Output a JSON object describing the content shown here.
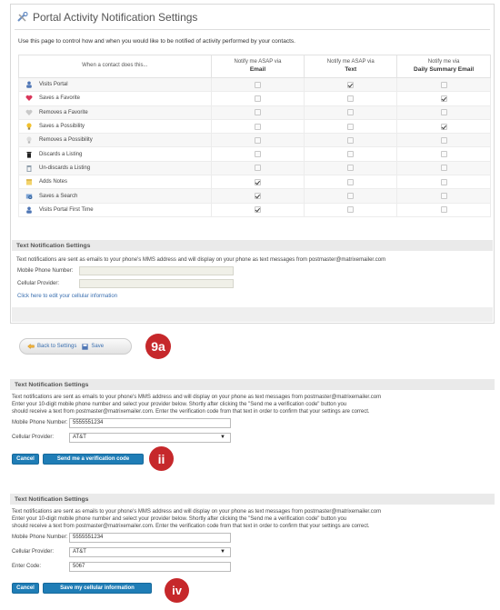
{
  "page": {
    "title": "Portal Activity Notification Settings",
    "intro": "Use this page to control how and when you would like to be notified of activity performed by your contacts."
  },
  "table": {
    "col_activity": "When a contact does this...",
    "col_email_top": "Notify me ASAP via",
    "col_email_bold": "Email",
    "col_text_top": "Notify me ASAP via",
    "col_text_bold": "Text",
    "col_daily_top": "Notify me via",
    "col_daily_bold": "Daily Summary Email",
    "rows": [
      {
        "label": "Visits Portal",
        "icon": "person-icon",
        "email": false,
        "text": true,
        "daily": false
      },
      {
        "label": "Saves a Favorite",
        "icon": "heart-icon",
        "email": false,
        "text": false,
        "daily": true
      },
      {
        "label": "Removes a Favorite",
        "icon": "heart-remove-icon",
        "email": false,
        "text": false,
        "daily": false
      },
      {
        "label": "Saves a Possibility",
        "icon": "lightbulb-icon",
        "email": false,
        "text": false,
        "daily": true
      },
      {
        "label": "Removes a Possibility",
        "icon": "lightbulb-remove-icon",
        "email": false,
        "text": false,
        "daily": false
      },
      {
        "label": "Discards a Listing",
        "icon": "trash-icon",
        "email": false,
        "text": false,
        "daily": false
      },
      {
        "label": "Un-discards a Listing",
        "icon": "trash-restore-icon",
        "email": false,
        "text": false,
        "daily": false
      },
      {
        "label": "Adds Notes",
        "icon": "notes-icon",
        "email": true,
        "text": false,
        "daily": false
      },
      {
        "label": "Saves a Search",
        "icon": "search-save-icon",
        "email": true,
        "text": false,
        "daily": false
      },
      {
        "label": "Visits Portal First Time",
        "icon": "person-icon",
        "email": true,
        "text": false,
        "daily": false
      }
    ]
  },
  "text_settings_1": {
    "heading": "Text Notification Settings",
    "description": "Text notifications are sent as emails to your phone's MMS address and will display on your phone as text messages from postmaster@matrixemailer.com",
    "mobile_label": "Mobile Phone Number:",
    "provider_label": "Cellular Provider:",
    "edit_link": "Click here to edit your cellular information"
  },
  "toolbar": {
    "back_label": "Back to Settings",
    "save_label": "Save"
  },
  "markers": {
    "m1": "9a",
    "m2": "ii",
    "m3": "iv"
  },
  "text_settings_2": {
    "heading": "Text Notification Settings",
    "line1": "Text notifications are sent as emails to your phone's MMS address and will display on your phone as text messages from postmaster@matrixemailer.com",
    "line2": "Enter your 10-digit mobile phone number and select your provider below. Shortly after clicking the \"Send me a verification code\" button you",
    "line3": "should receive a text from postmaster@matrixemailer.com. Enter the verification code from that text in order to confirm that your settings are correct.",
    "mobile_label": "Mobile Phone Number:",
    "mobile_value": "5555551234",
    "provider_label": "Cellular Provider:",
    "provider_value": "AT&T",
    "cancel_label": "Cancel",
    "send_label": "Send me a verification code"
  },
  "text_settings_3": {
    "heading": "Text Notification Settings",
    "line1": "Text notifications are sent as emails to your phone's MMS address and will display on your phone as text messages from postmaster@matrixemailer.com",
    "line2": "Enter your 10-digit mobile phone number and select your provider below. Shortly after clicking the \"Send me a verification code\" button you",
    "line3": "should receive a text from postmaster@matrixemailer.com. Enter the verification code from that text in order to confirm that your settings are correct.",
    "mobile_label": "Mobile Phone Number:",
    "mobile_value": "5555551234",
    "provider_label": "Cellular Provider:",
    "provider_value": "AT&T",
    "code_label": "Enter Code:",
    "code_value": "5067",
    "cancel_label": "Cancel",
    "save_label": "Save my cellular information"
  }
}
